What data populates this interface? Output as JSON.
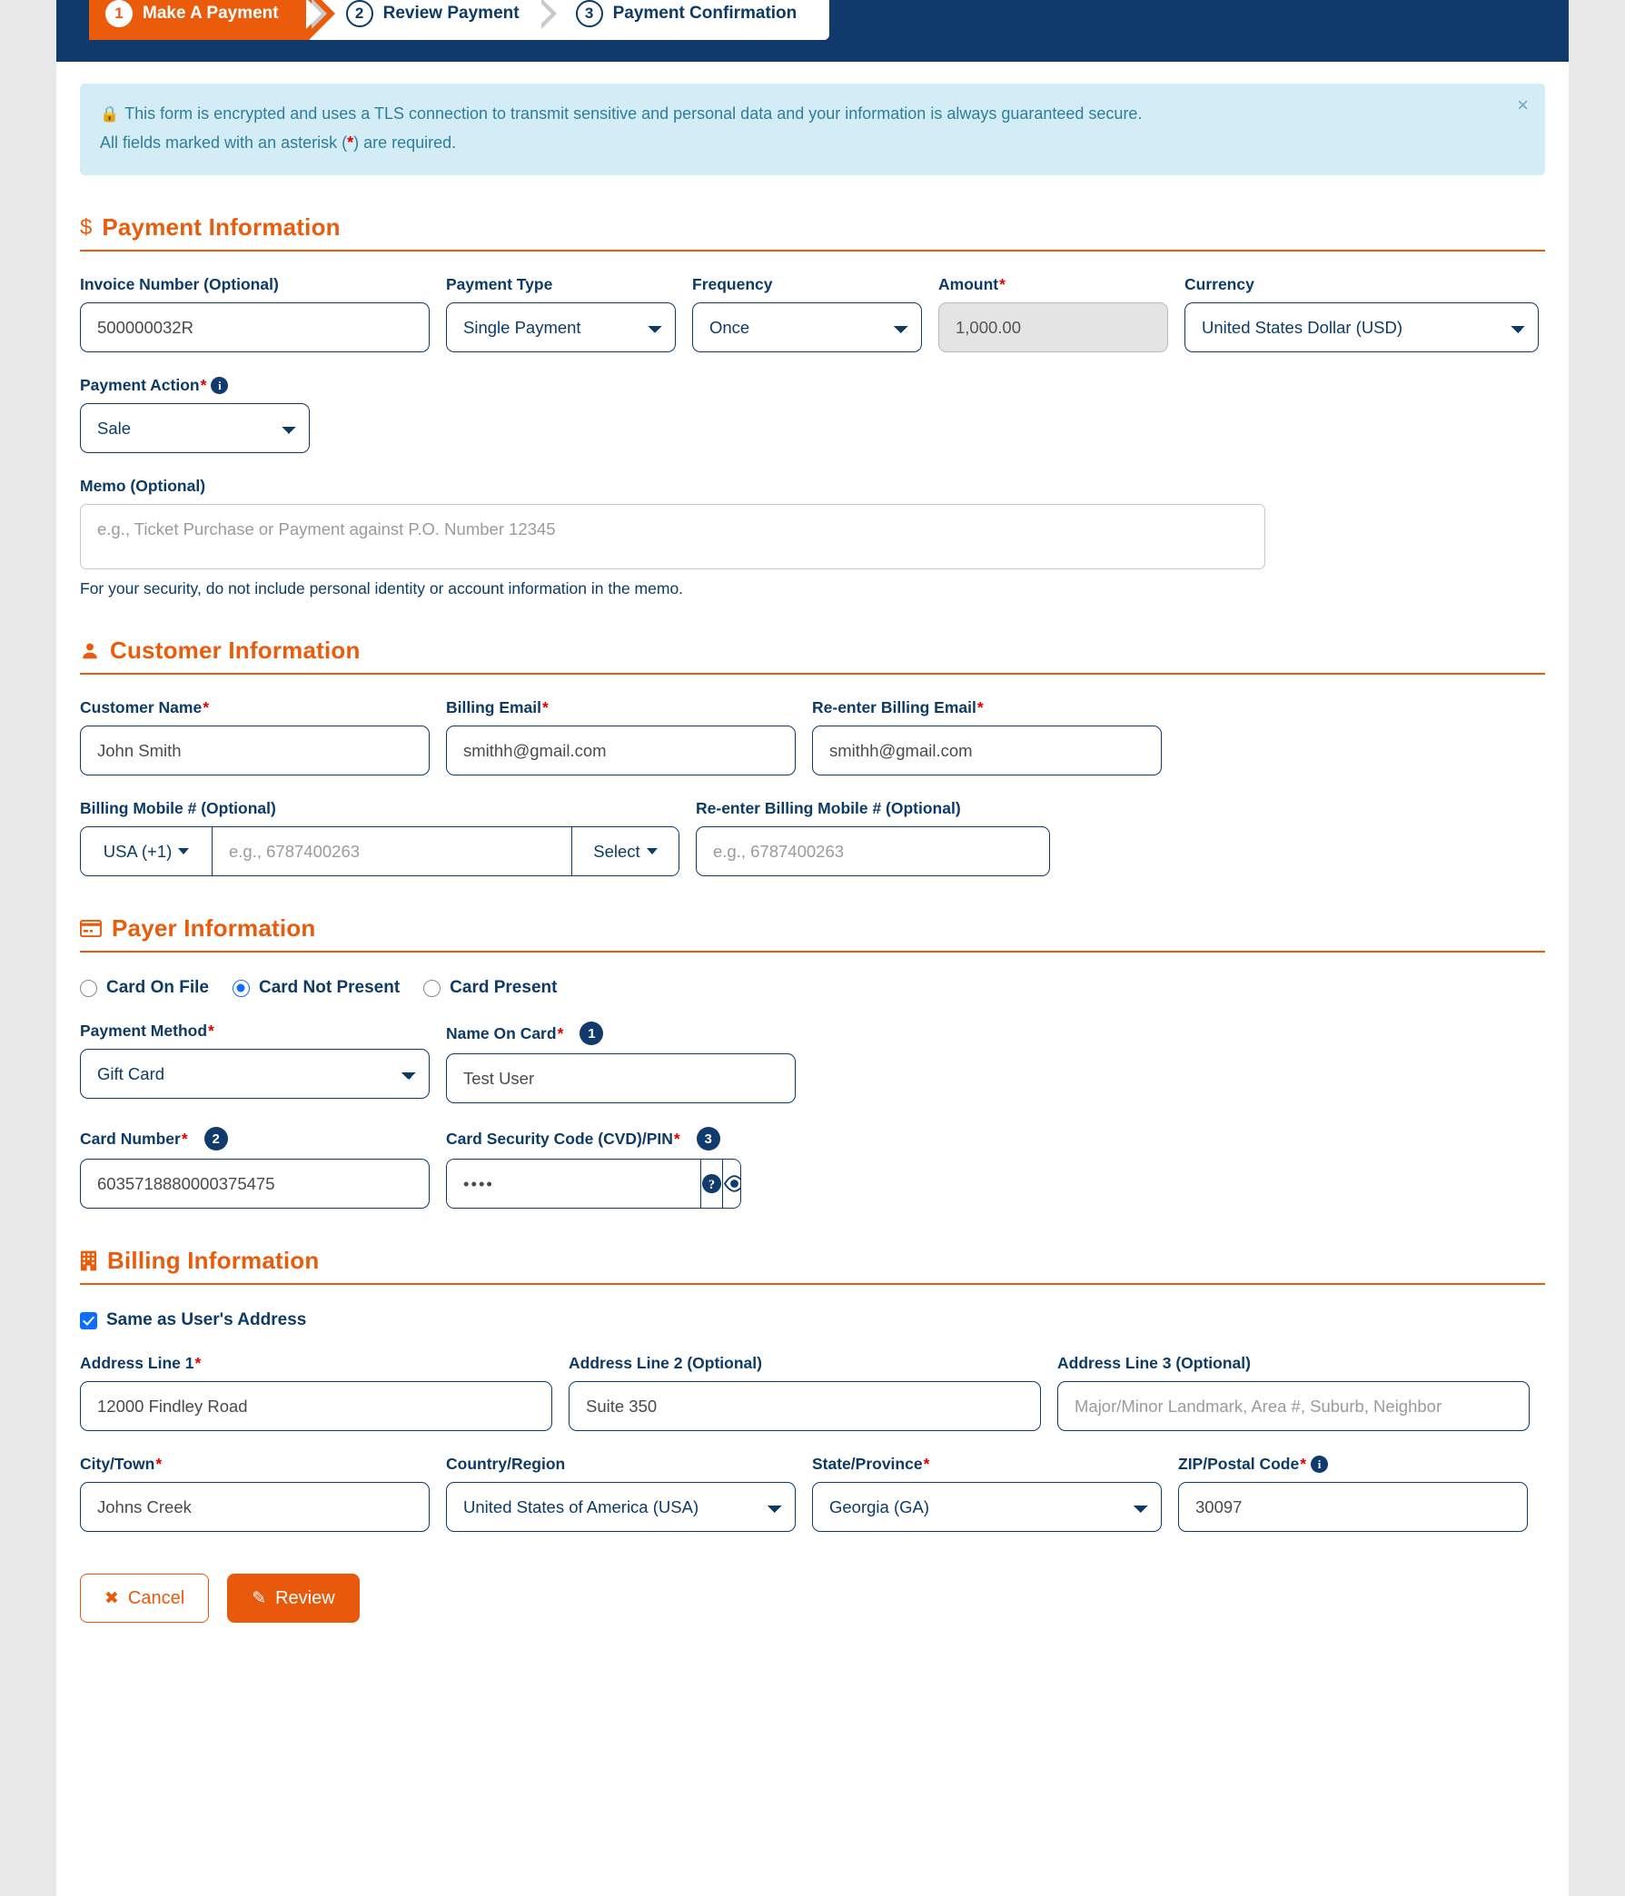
{
  "stepper": {
    "steps": [
      {
        "num": "1",
        "label": "Make A Payment",
        "state": "active"
      },
      {
        "num": "2",
        "label": "Review Payment",
        "state": "todo"
      },
      {
        "num": "3",
        "label": "Payment Confirmation",
        "state": "todo"
      }
    ]
  },
  "alert": {
    "icon": "lock-icon",
    "line1": "This form is encrypted and uses a TLS connection to transmit sensitive and personal data and your information is always guaranteed secure.",
    "line2_pre": "All fields marked with an asterisk (",
    "line2_ast": "*",
    "line2_post": ") are required.",
    "close_label": "×"
  },
  "payment_information": {
    "section_title": "Payment Information",
    "section_icon": "dollar-icon",
    "invoice_number": {
      "label": "Invoice Number (Optional)",
      "value": "500000032R"
    },
    "payment_type": {
      "label": "Payment Type",
      "value": "Single Payment"
    },
    "frequency": {
      "label": "Frequency",
      "value": "Once"
    },
    "amount": {
      "label": "Amount",
      "required": "*",
      "value": "1,000.00",
      "disabled": true
    },
    "currency": {
      "label": "Currency",
      "value": "United States Dollar (USD)"
    },
    "payment_action": {
      "label": "Payment Action",
      "required": "*",
      "value": "Sale",
      "info": "i"
    },
    "memo": {
      "label": "Memo (Optional)",
      "placeholder": "e.g., Ticket Purchase or Payment against P.O. Number 12345",
      "value": ""
    },
    "memo_help": "For your security, do not include personal identity or account information in the memo."
  },
  "customer_information": {
    "section_title": "Customer Information",
    "section_icon": "user-icon",
    "customer_name": {
      "label": "Customer Name",
      "required": "*",
      "value": "John Smith"
    },
    "billing_email": {
      "label": "Billing Email",
      "required": "*",
      "value": "smithh@gmail.com"
    },
    "reenter_billing_email": {
      "label": "Re-enter Billing Email",
      "required": "*",
      "value": "smithh@gmail.com"
    },
    "billing_mobile": {
      "label": "Billing Mobile # (Optional)",
      "country_code": "USA (+1)",
      "placeholder": "e.g., 6787400263",
      "value": "",
      "select_label": "Select"
    },
    "reenter_billing_mobile": {
      "label": "Re-enter Billing Mobile # (Optional)",
      "placeholder": "e.g., 6787400263",
      "value": ""
    }
  },
  "payer_information": {
    "section_title": "Payer Information",
    "section_icon": "credit-card-icon",
    "card_source_options": [
      {
        "label": "Card On File",
        "selected": false
      },
      {
        "label": "Card Not Present",
        "selected": true
      },
      {
        "label": "Card Present",
        "selected": false
      }
    ],
    "payment_method": {
      "label": "Payment Method",
      "required": "*",
      "value": "Gift Card"
    },
    "name_on_card": {
      "label": "Name On Card",
      "required": "*",
      "badge": "1",
      "value": "Test User"
    },
    "card_number": {
      "label": "Card Number",
      "required": "*",
      "badge": "2",
      "value": "6035718880000375475"
    },
    "card_security_code": {
      "label": "Card Security Code (CVD)/PIN",
      "required": "*",
      "badge": "3",
      "value": "••••",
      "help_icon": "question-circle-icon",
      "reveal_icon": "eye-icon"
    }
  },
  "billing_information": {
    "section_title": "Billing Information",
    "section_icon": "building-icon",
    "same_as_user_address": {
      "label": "Same as User's Address",
      "checked": true
    },
    "address_line_1": {
      "label": "Address Line 1",
      "required": "*",
      "value": "12000 Findley Road"
    },
    "address_line_2": {
      "label": "Address Line 2 (Optional)",
      "value": "Suite 350"
    },
    "address_line_3": {
      "label": "Address Line 3 (Optional)",
      "placeholder": "Major/Minor Landmark, Area #, Suburb, Neighbor",
      "value": ""
    },
    "city_town": {
      "label": "City/Town",
      "required": "*",
      "value": "Johns Creek"
    },
    "country_region": {
      "label": "Country/Region",
      "value": "United States of America (USA)"
    },
    "state_province": {
      "label": "State/Province",
      "required": "*",
      "value": "Georgia (GA)"
    },
    "zip_postal_code": {
      "label": "ZIP/Postal Code",
      "required": "*",
      "info": "i",
      "value": "30097"
    }
  },
  "actions": {
    "cancel": {
      "label": "Cancel",
      "icon": "x-icon",
      "glyph": "✖"
    },
    "review": {
      "label": "Review",
      "icon": "pencil-icon",
      "glyph": "✎"
    }
  },
  "colors": {
    "brand_orange": "#ea5b0c",
    "brand_navy": "#0d3b66",
    "header_blue": "#103a6b",
    "info_bg": "#d3ecf5",
    "required_red": "#e00000"
  }
}
